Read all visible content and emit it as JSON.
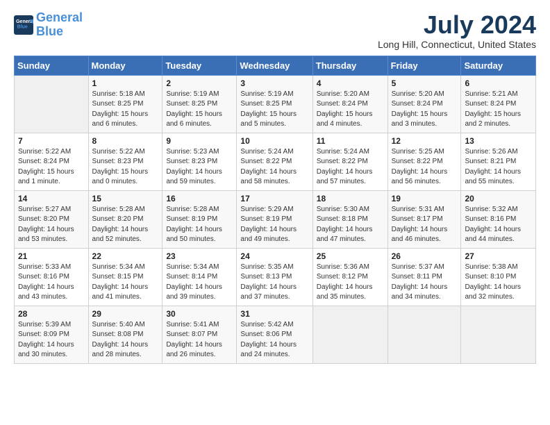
{
  "logo": {
    "line1": "General",
    "line2": "Blue"
  },
  "title": "July 2024",
  "location": "Long Hill, Connecticut, United States",
  "days_of_week": [
    "Sunday",
    "Monday",
    "Tuesday",
    "Wednesday",
    "Thursday",
    "Friday",
    "Saturday"
  ],
  "weeks": [
    [
      {
        "day": "",
        "info": ""
      },
      {
        "day": "1",
        "info": "Sunrise: 5:18 AM\nSunset: 8:25 PM\nDaylight: 15 hours\nand 6 minutes."
      },
      {
        "day": "2",
        "info": "Sunrise: 5:19 AM\nSunset: 8:25 PM\nDaylight: 15 hours\nand 6 minutes."
      },
      {
        "day": "3",
        "info": "Sunrise: 5:19 AM\nSunset: 8:25 PM\nDaylight: 15 hours\nand 5 minutes."
      },
      {
        "day": "4",
        "info": "Sunrise: 5:20 AM\nSunset: 8:24 PM\nDaylight: 15 hours\nand 4 minutes."
      },
      {
        "day": "5",
        "info": "Sunrise: 5:20 AM\nSunset: 8:24 PM\nDaylight: 15 hours\nand 3 minutes."
      },
      {
        "day": "6",
        "info": "Sunrise: 5:21 AM\nSunset: 8:24 PM\nDaylight: 15 hours\nand 2 minutes."
      }
    ],
    [
      {
        "day": "7",
        "info": "Sunrise: 5:22 AM\nSunset: 8:24 PM\nDaylight: 15 hours\nand 1 minute."
      },
      {
        "day": "8",
        "info": "Sunrise: 5:22 AM\nSunset: 8:23 PM\nDaylight: 15 hours\nand 0 minutes."
      },
      {
        "day": "9",
        "info": "Sunrise: 5:23 AM\nSunset: 8:23 PM\nDaylight: 14 hours\nand 59 minutes."
      },
      {
        "day": "10",
        "info": "Sunrise: 5:24 AM\nSunset: 8:22 PM\nDaylight: 14 hours\nand 58 minutes."
      },
      {
        "day": "11",
        "info": "Sunrise: 5:24 AM\nSunset: 8:22 PM\nDaylight: 14 hours\nand 57 minutes."
      },
      {
        "day": "12",
        "info": "Sunrise: 5:25 AM\nSunset: 8:22 PM\nDaylight: 14 hours\nand 56 minutes."
      },
      {
        "day": "13",
        "info": "Sunrise: 5:26 AM\nSunset: 8:21 PM\nDaylight: 14 hours\nand 55 minutes."
      }
    ],
    [
      {
        "day": "14",
        "info": "Sunrise: 5:27 AM\nSunset: 8:20 PM\nDaylight: 14 hours\nand 53 minutes."
      },
      {
        "day": "15",
        "info": "Sunrise: 5:28 AM\nSunset: 8:20 PM\nDaylight: 14 hours\nand 52 minutes."
      },
      {
        "day": "16",
        "info": "Sunrise: 5:28 AM\nSunset: 8:19 PM\nDaylight: 14 hours\nand 50 minutes."
      },
      {
        "day": "17",
        "info": "Sunrise: 5:29 AM\nSunset: 8:19 PM\nDaylight: 14 hours\nand 49 minutes."
      },
      {
        "day": "18",
        "info": "Sunrise: 5:30 AM\nSunset: 8:18 PM\nDaylight: 14 hours\nand 47 minutes."
      },
      {
        "day": "19",
        "info": "Sunrise: 5:31 AM\nSunset: 8:17 PM\nDaylight: 14 hours\nand 46 minutes."
      },
      {
        "day": "20",
        "info": "Sunrise: 5:32 AM\nSunset: 8:16 PM\nDaylight: 14 hours\nand 44 minutes."
      }
    ],
    [
      {
        "day": "21",
        "info": "Sunrise: 5:33 AM\nSunset: 8:16 PM\nDaylight: 14 hours\nand 43 minutes."
      },
      {
        "day": "22",
        "info": "Sunrise: 5:34 AM\nSunset: 8:15 PM\nDaylight: 14 hours\nand 41 minutes."
      },
      {
        "day": "23",
        "info": "Sunrise: 5:34 AM\nSunset: 8:14 PM\nDaylight: 14 hours\nand 39 minutes."
      },
      {
        "day": "24",
        "info": "Sunrise: 5:35 AM\nSunset: 8:13 PM\nDaylight: 14 hours\nand 37 minutes."
      },
      {
        "day": "25",
        "info": "Sunrise: 5:36 AM\nSunset: 8:12 PM\nDaylight: 14 hours\nand 35 minutes."
      },
      {
        "day": "26",
        "info": "Sunrise: 5:37 AM\nSunset: 8:11 PM\nDaylight: 14 hours\nand 34 minutes."
      },
      {
        "day": "27",
        "info": "Sunrise: 5:38 AM\nSunset: 8:10 PM\nDaylight: 14 hours\nand 32 minutes."
      }
    ],
    [
      {
        "day": "28",
        "info": "Sunrise: 5:39 AM\nSunset: 8:09 PM\nDaylight: 14 hours\nand 30 minutes."
      },
      {
        "day": "29",
        "info": "Sunrise: 5:40 AM\nSunset: 8:08 PM\nDaylight: 14 hours\nand 28 minutes."
      },
      {
        "day": "30",
        "info": "Sunrise: 5:41 AM\nSunset: 8:07 PM\nDaylight: 14 hours\nand 26 minutes."
      },
      {
        "day": "31",
        "info": "Sunrise: 5:42 AM\nSunset: 8:06 PM\nDaylight: 14 hours\nand 24 minutes."
      },
      {
        "day": "",
        "info": ""
      },
      {
        "day": "",
        "info": ""
      },
      {
        "day": "",
        "info": ""
      }
    ]
  ]
}
